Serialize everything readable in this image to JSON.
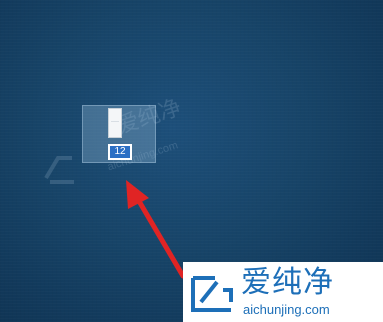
{
  "desktop": {
    "background_color": "#174468",
    "icon": {
      "name_value": "12",
      "state": "renaming",
      "selection_color": "#2b6fc4"
    }
  },
  "annotation": {
    "arrow_color": "#e02424"
  },
  "watermark": {
    "name": "爱纯净",
    "url": "aichunjing.com",
    "color": "#1d6fb8"
  }
}
